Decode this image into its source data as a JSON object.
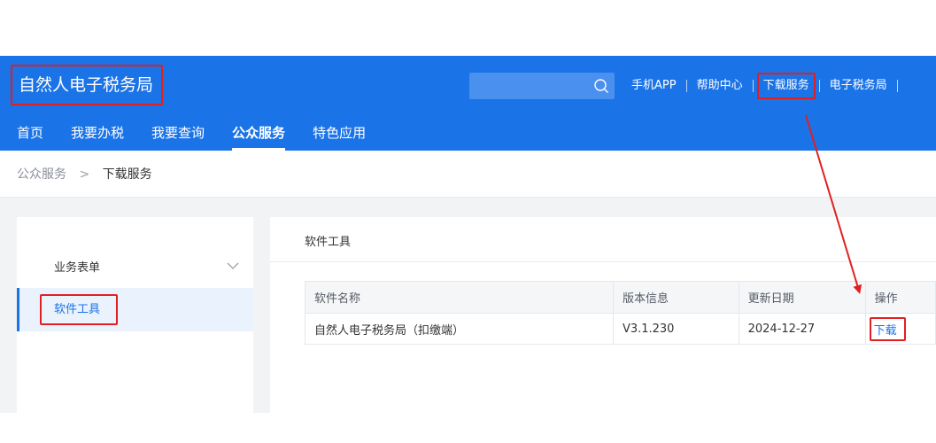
{
  "header": {
    "logo": "自然人电子税务局",
    "search_placeholder": "",
    "links": [
      "手机APP",
      "帮助中心",
      "下载服务",
      "电子税务局"
    ],
    "accent_color": "#1b73e8"
  },
  "nav": {
    "items": [
      "首页",
      "我要办税",
      "我要查询",
      "公众服务",
      "特色应用"
    ],
    "active": "公众服务"
  },
  "breadcrumb": {
    "parent": "公众服务",
    "separator": ">",
    "current": "下载服务"
  },
  "sidebar": {
    "group_label": "业务表单",
    "active_item": "软件工具"
  },
  "main": {
    "title": "软件工具",
    "table": {
      "headers": [
        "软件名称",
        "版本信息",
        "更新日期",
        "操作"
      ],
      "rows": [
        {
          "name": "自然人电子税务局（扣缴端）",
          "version": "V3.1.230",
          "date": "2024-12-27",
          "action": "下载"
        }
      ]
    }
  },
  "annotation_color": "#e02020",
  "icons": [
    "search-icon",
    "chevron-down-icon"
  ]
}
